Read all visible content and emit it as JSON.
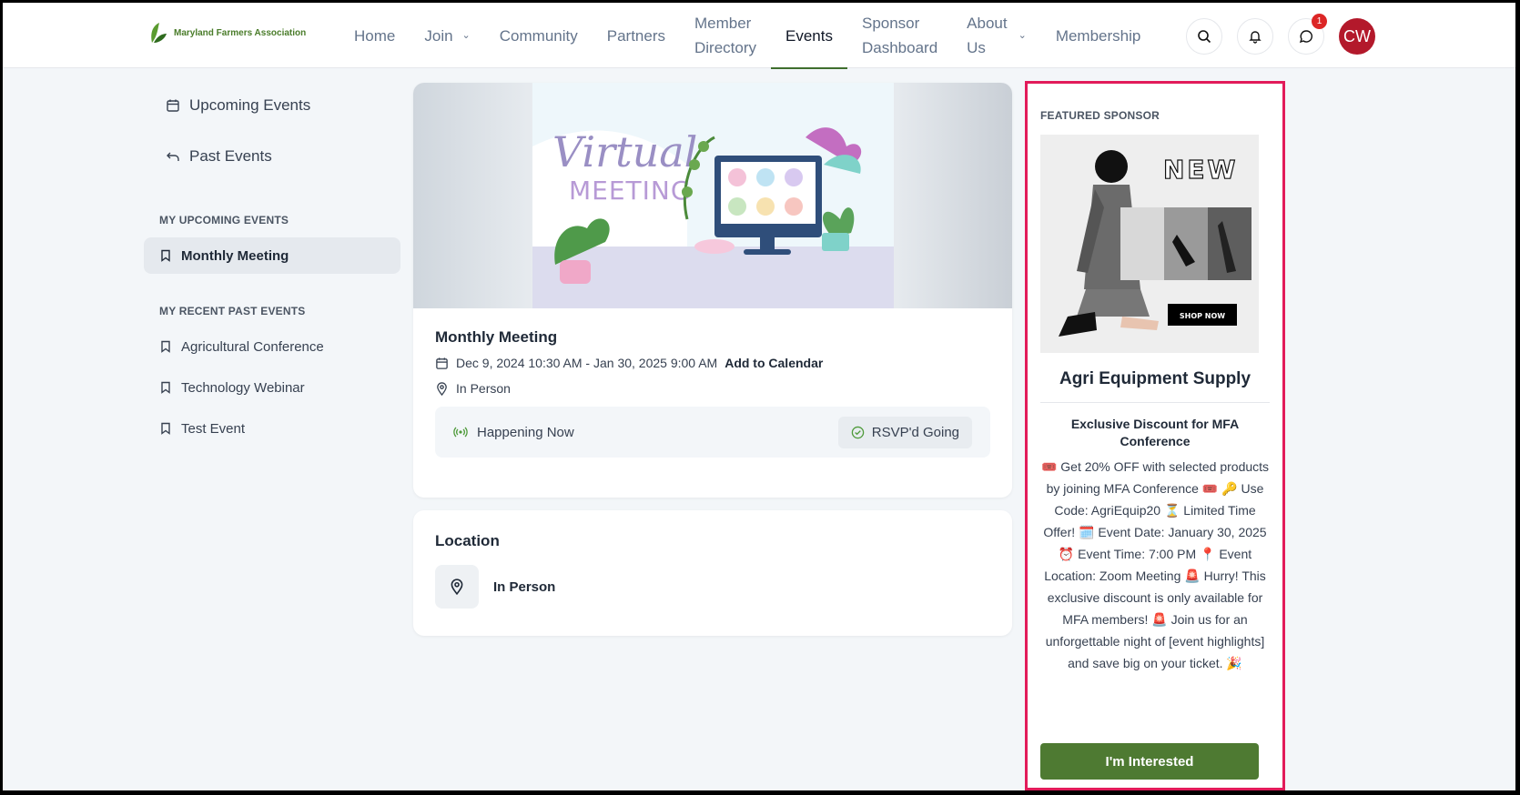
{
  "header": {
    "logo_text": "Maryland Farmers Association",
    "nav": {
      "home": "Home",
      "join": "Join",
      "community": "Community",
      "partners": "Partners",
      "member_directory_l1": "Member",
      "member_directory_l2": "Directory",
      "events": "Events",
      "sponsor_dashboard_l1": "Sponsor",
      "sponsor_dashboard_l2": "Dashboard",
      "about_l1": "About",
      "about_l2": "Us",
      "membership": "Membership"
    },
    "notification_badge": "1",
    "avatar_initials": "CW"
  },
  "sidebar": {
    "upcoming_events": "Upcoming Events",
    "past_events": "Past Events",
    "my_upcoming_heading": "MY UPCOMING EVENTS",
    "my_upcoming": [
      "Monthly Meeting"
    ],
    "my_recent_heading": "MY RECENT PAST EVENTS",
    "my_recent": [
      "Agricultural Conference",
      "Technology Webinar",
      "Test Event"
    ]
  },
  "event": {
    "banner_title_1": "Virtual",
    "banner_title_2": "MEETING",
    "title": "Monthly Meeting",
    "datetime": "Dec 9, 2024 10:30 AM - Jan 30, 2025 9:00 AM",
    "add_to_calendar": "Add to Calendar",
    "location_type": "In Person",
    "status": "Happening Now",
    "rsvp": "RSVP'd Going"
  },
  "location": {
    "title": "Location",
    "value": "In Person"
  },
  "sponsor": {
    "label": "FEATURED SPONSOR",
    "ad_new": "NEW",
    "ad_shop_now": "SHOP NOW",
    "name": "Agri Equipment Supply",
    "headline": "Exclusive Discount for MFA Conference",
    "description": "🎟️ Get 20% OFF with selected products by joining MFA Conference 🎟️ 🔑 Use Code: AgriEquip20 ⏳ Limited Time Offer! 🗓️ Event Date: January 30, 2025 ⏰ Event Time: 7:00 PM 📍 Event Location: Zoom Meeting 🚨 Hurry! This exclusive discount is only available for MFA members! 🚨 Join us for an unforgettable night of [event highlights] and save big on your ticket. 🎉",
    "button": "I'm Interested"
  },
  "colors": {
    "brand_green": "#4e7a32",
    "highlight_border": "#e21b5a",
    "avatar": "#b3192b",
    "badge": "#dc2626"
  }
}
